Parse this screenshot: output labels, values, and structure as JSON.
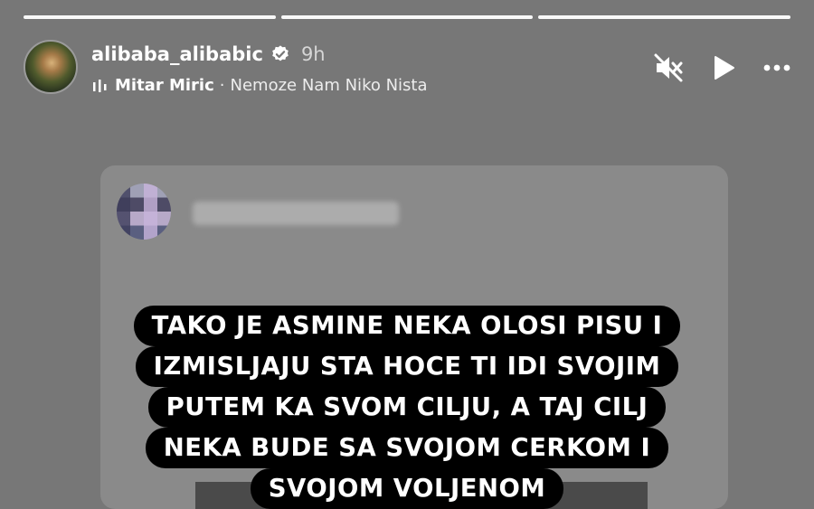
{
  "story": {
    "segments": 3,
    "username": "alibaba_alibabic",
    "time": "9h",
    "music": {
      "artist": "Mitar Miric",
      "separator": " · ",
      "title": "Nemoze Nam Niko Nista"
    }
  },
  "icons": {
    "verified": "verified-badge-icon",
    "music": "music-bars-icon",
    "mute": "speaker-muted-icon",
    "play": "play-icon",
    "more": "more-options-icon"
  },
  "caption": {
    "lines": [
      "TAKO JE ASMINE  NEKA OLOSI PISU I",
      "IZMISLJAJU STA HOCE TI IDI SVOJIM",
      "PUTEM KA SVOM CILJU, A TAJ CILJ",
      "NEKA BUDE SA SVOJOM CERKOM I",
      "SVOJOM VOLJENOM"
    ]
  },
  "colors": {
    "background": "#777777",
    "card": "#8a8a8a",
    "caption_bg": "#000000",
    "text": "#ffffff"
  }
}
